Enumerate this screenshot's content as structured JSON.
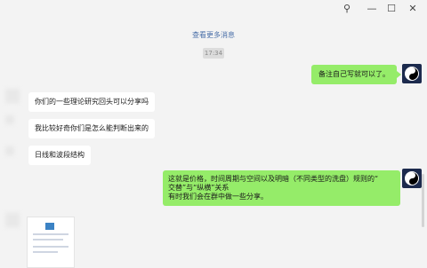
{
  "window": {
    "pin_icon": "pin-icon",
    "minimize_icon": "minimize-icon",
    "maximize_icon": "maximize-icon",
    "close_icon": "close-icon"
  },
  "chat": {
    "more_messages": "查看更多消息",
    "timestamp": "17:34",
    "messages": [
      {
        "from": "me",
        "text": "备注自己写就可以了。"
      },
      {
        "from": "other",
        "text": "你们的一些理论研究回头可以分享吗"
      },
      {
        "from": "other",
        "text": "我比较好奇你们是怎么能判断出来的"
      },
      {
        "from": "other",
        "text": "日线和波段结构"
      },
      {
        "from": "me",
        "lines": [
          "这就是价格，时间周期与空间以及明暗（不同类型的洗盘）规则的“",
          "交替”与“纵横”关系",
          "有时我们会在群中做一些分享。"
        ]
      }
    ]
  },
  "colors": {
    "outgoing_bubble": "#95ec69",
    "incoming_bubble": "#ffffff",
    "link": "#4a6fa8",
    "background": "#f3f3f3"
  }
}
